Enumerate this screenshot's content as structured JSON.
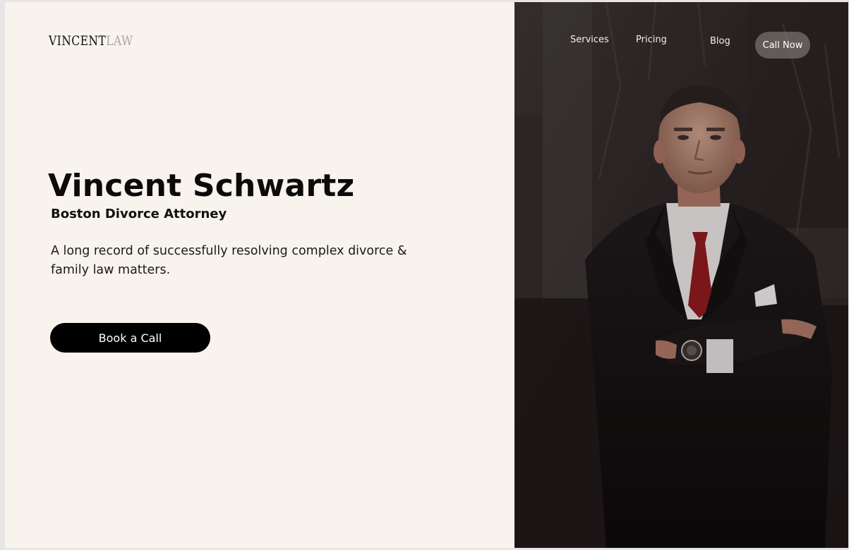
{
  "brand": {
    "logo_primary": "VINCENT",
    "logo_secondary": "LAW"
  },
  "hero": {
    "name": "Vincent Schwartz",
    "subtitle": "Boston Divorce Attorney",
    "description": "A long record of successfully resolving complex divorce & family law matters.",
    "cta_label": "Book a Call"
  },
  "nav": {
    "items": [
      {
        "label": "Services"
      },
      {
        "label": "Pricing"
      },
      {
        "label": "Blog"
      }
    ],
    "call_label": "Call Now"
  },
  "colors": {
    "background": "#f8f3ed",
    "text": "#0b0b0b",
    "button": "#000000",
    "logo_muted": "#a9a6a2",
    "tie_accent": "#8c1a1f"
  },
  "icons": {
    "photo": "attorney-portrait-image"
  }
}
